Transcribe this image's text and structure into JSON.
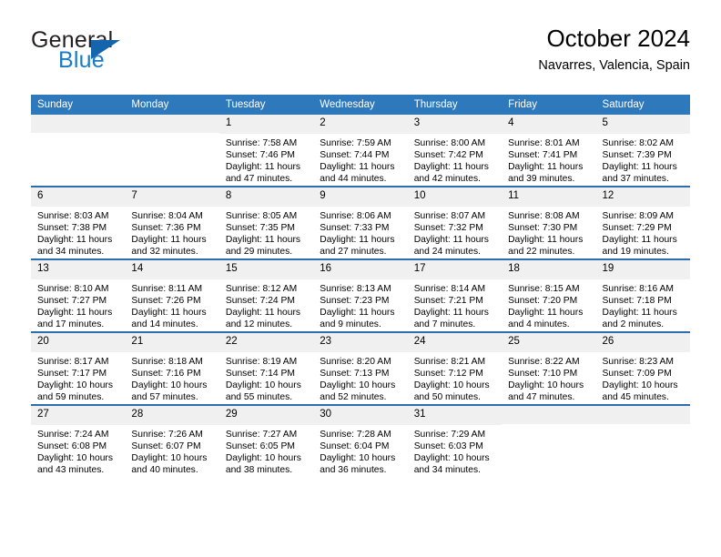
{
  "brand": {
    "name_top": "General",
    "name_bottom": "Blue",
    "triangle_color": "#1565ad",
    "blue_text_color": "#1a7bc4"
  },
  "header": {
    "title": "October 2024",
    "subtitle": "Navarres, Valencia, Spain"
  },
  "theme": {
    "header_blue": "#2e78bc",
    "row_rule_blue": "#2a6db0",
    "daynum_band": "#f0f0f0"
  },
  "weekday_headers": [
    "Sunday",
    "Monday",
    "Tuesday",
    "Wednesday",
    "Thursday",
    "Friday",
    "Saturday"
  ],
  "weeks": [
    [
      {
        "day": "",
        "empty": true,
        "sunrise": "",
        "sunset": "",
        "daylight_line1": "",
        "daylight_line2": ""
      },
      {
        "day": "",
        "empty": true,
        "sunrise": "",
        "sunset": "",
        "daylight_line1": "",
        "daylight_line2": ""
      },
      {
        "day": "1",
        "sunrise": "Sunrise: 7:58 AM",
        "sunset": "Sunset: 7:46 PM",
        "daylight_line1": "Daylight: 11 hours",
        "daylight_line2": "and 47 minutes."
      },
      {
        "day": "2",
        "sunrise": "Sunrise: 7:59 AM",
        "sunset": "Sunset: 7:44 PM",
        "daylight_line1": "Daylight: 11 hours",
        "daylight_line2": "and 44 minutes."
      },
      {
        "day": "3",
        "sunrise": "Sunrise: 8:00 AM",
        "sunset": "Sunset: 7:42 PM",
        "daylight_line1": "Daylight: 11 hours",
        "daylight_line2": "and 42 minutes."
      },
      {
        "day": "4",
        "sunrise": "Sunrise: 8:01 AM",
        "sunset": "Sunset: 7:41 PM",
        "daylight_line1": "Daylight: 11 hours",
        "daylight_line2": "and 39 minutes."
      },
      {
        "day": "5",
        "sunrise": "Sunrise: 8:02 AM",
        "sunset": "Sunset: 7:39 PM",
        "daylight_line1": "Daylight: 11 hours",
        "daylight_line2": "and 37 minutes."
      }
    ],
    [
      {
        "day": "6",
        "sunrise": "Sunrise: 8:03 AM",
        "sunset": "Sunset: 7:38 PM",
        "daylight_line1": "Daylight: 11 hours",
        "daylight_line2": "and 34 minutes."
      },
      {
        "day": "7",
        "sunrise": "Sunrise: 8:04 AM",
        "sunset": "Sunset: 7:36 PM",
        "daylight_line1": "Daylight: 11 hours",
        "daylight_line2": "and 32 minutes."
      },
      {
        "day": "8",
        "sunrise": "Sunrise: 8:05 AM",
        "sunset": "Sunset: 7:35 PM",
        "daylight_line1": "Daylight: 11 hours",
        "daylight_line2": "and 29 minutes."
      },
      {
        "day": "9",
        "sunrise": "Sunrise: 8:06 AM",
        "sunset": "Sunset: 7:33 PM",
        "daylight_line1": "Daylight: 11 hours",
        "daylight_line2": "and 27 minutes."
      },
      {
        "day": "10",
        "sunrise": "Sunrise: 8:07 AM",
        "sunset": "Sunset: 7:32 PM",
        "daylight_line1": "Daylight: 11 hours",
        "daylight_line2": "and 24 minutes."
      },
      {
        "day": "11",
        "sunrise": "Sunrise: 8:08 AM",
        "sunset": "Sunset: 7:30 PM",
        "daylight_line1": "Daylight: 11 hours",
        "daylight_line2": "and 22 minutes."
      },
      {
        "day": "12",
        "sunrise": "Sunrise: 8:09 AM",
        "sunset": "Sunset: 7:29 PM",
        "daylight_line1": "Daylight: 11 hours",
        "daylight_line2": "and 19 minutes."
      }
    ],
    [
      {
        "day": "13",
        "sunrise": "Sunrise: 8:10 AM",
        "sunset": "Sunset: 7:27 PM",
        "daylight_line1": "Daylight: 11 hours",
        "daylight_line2": "and 17 minutes."
      },
      {
        "day": "14",
        "sunrise": "Sunrise: 8:11 AM",
        "sunset": "Sunset: 7:26 PM",
        "daylight_line1": "Daylight: 11 hours",
        "daylight_line2": "and 14 minutes."
      },
      {
        "day": "15",
        "sunrise": "Sunrise: 8:12 AM",
        "sunset": "Sunset: 7:24 PM",
        "daylight_line1": "Daylight: 11 hours",
        "daylight_line2": "and 12 minutes."
      },
      {
        "day": "16",
        "sunrise": "Sunrise: 8:13 AM",
        "sunset": "Sunset: 7:23 PM",
        "daylight_line1": "Daylight: 11 hours",
        "daylight_line2": "and 9 minutes."
      },
      {
        "day": "17",
        "sunrise": "Sunrise: 8:14 AM",
        "sunset": "Sunset: 7:21 PM",
        "daylight_line1": "Daylight: 11 hours",
        "daylight_line2": "and 7 minutes."
      },
      {
        "day": "18",
        "sunrise": "Sunrise: 8:15 AM",
        "sunset": "Sunset: 7:20 PM",
        "daylight_line1": "Daylight: 11 hours",
        "daylight_line2": "and 4 minutes."
      },
      {
        "day": "19",
        "sunrise": "Sunrise: 8:16 AM",
        "sunset": "Sunset: 7:18 PM",
        "daylight_line1": "Daylight: 11 hours",
        "daylight_line2": "and 2 minutes."
      }
    ],
    [
      {
        "day": "20",
        "sunrise": "Sunrise: 8:17 AM",
        "sunset": "Sunset: 7:17 PM",
        "daylight_line1": "Daylight: 10 hours",
        "daylight_line2": "and 59 minutes."
      },
      {
        "day": "21",
        "sunrise": "Sunrise: 8:18 AM",
        "sunset": "Sunset: 7:16 PM",
        "daylight_line1": "Daylight: 10 hours",
        "daylight_line2": "and 57 minutes."
      },
      {
        "day": "22",
        "sunrise": "Sunrise: 8:19 AM",
        "sunset": "Sunset: 7:14 PM",
        "daylight_line1": "Daylight: 10 hours",
        "daylight_line2": "and 55 minutes."
      },
      {
        "day": "23",
        "sunrise": "Sunrise: 8:20 AM",
        "sunset": "Sunset: 7:13 PM",
        "daylight_line1": "Daylight: 10 hours",
        "daylight_line2": "and 52 minutes."
      },
      {
        "day": "24",
        "sunrise": "Sunrise: 8:21 AM",
        "sunset": "Sunset: 7:12 PM",
        "daylight_line1": "Daylight: 10 hours",
        "daylight_line2": "and 50 minutes."
      },
      {
        "day": "25",
        "sunrise": "Sunrise: 8:22 AM",
        "sunset": "Sunset: 7:10 PM",
        "daylight_line1": "Daylight: 10 hours",
        "daylight_line2": "and 47 minutes."
      },
      {
        "day": "26",
        "sunrise": "Sunrise: 8:23 AM",
        "sunset": "Sunset: 7:09 PM",
        "daylight_line1": "Daylight: 10 hours",
        "daylight_line2": "and 45 minutes."
      }
    ],
    [
      {
        "day": "27",
        "sunrise": "Sunrise: 7:24 AM",
        "sunset": "Sunset: 6:08 PM",
        "daylight_line1": "Daylight: 10 hours",
        "daylight_line2": "and 43 minutes."
      },
      {
        "day": "28",
        "sunrise": "Sunrise: 7:26 AM",
        "sunset": "Sunset: 6:07 PM",
        "daylight_line1": "Daylight: 10 hours",
        "daylight_line2": "and 40 minutes."
      },
      {
        "day": "29",
        "sunrise": "Sunrise: 7:27 AM",
        "sunset": "Sunset: 6:05 PM",
        "daylight_line1": "Daylight: 10 hours",
        "daylight_line2": "and 38 minutes."
      },
      {
        "day": "30",
        "sunrise": "Sunrise: 7:28 AM",
        "sunset": "Sunset: 6:04 PM",
        "daylight_line1": "Daylight: 10 hours",
        "daylight_line2": "and 36 minutes."
      },
      {
        "day": "31",
        "sunrise": "Sunrise: 7:29 AM",
        "sunset": "Sunset: 6:03 PM",
        "daylight_line1": "Daylight: 10 hours",
        "daylight_line2": "and 34 minutes."
      },
      {
        "day": "",
        "empty": true,
        "sunrise": "",
        "sunset": "",
        "daylight_line1": "",
        "daylight_line2": ""
      },
      {
        "day": "",
        "empty": true,
        "sunrise": "",
        "sunset": "",
        "daylight_line1": "",
        "daylight_line2": ""
      }
    ]
  ]
}
